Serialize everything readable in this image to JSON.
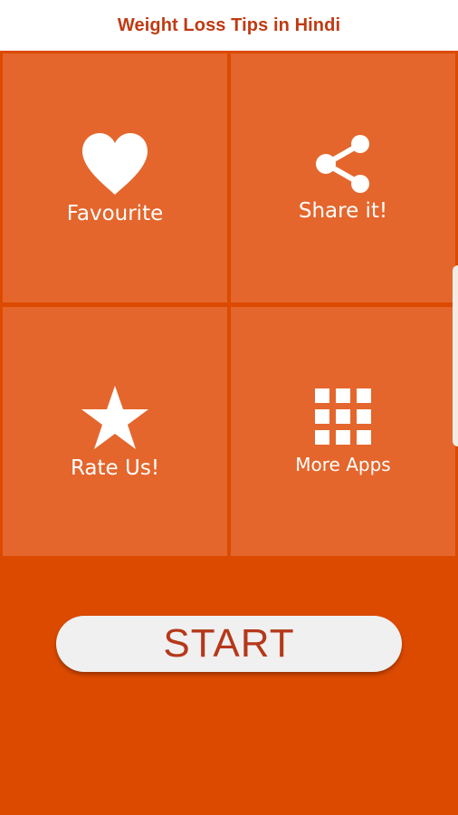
{
  "app": {
    "title": "Weight Loss Tips in Hindi"
  },
  "tiles": [
    {
      "label": "Favourite",
      "icon": "heart-icon"
    },
    {
      "label": "Share it!",
      "icon": "share-icon"
    },
    {
      "label": "Rate Us!",
      "icon": "star-icon"
    },
    {
      "label": "More Apps",
      "icon": "grid-icon"
    }
  ],
  "start": {
    "label": "START"
  },
  "colors": {
    "title_text": "#c03a12",
    "tile_background": "#e4662c",
    "page_background": "#dc4a00",
    "start_button_background": "#f0f0f0",
    "start_button_text": "#b5381a"
  }
}
